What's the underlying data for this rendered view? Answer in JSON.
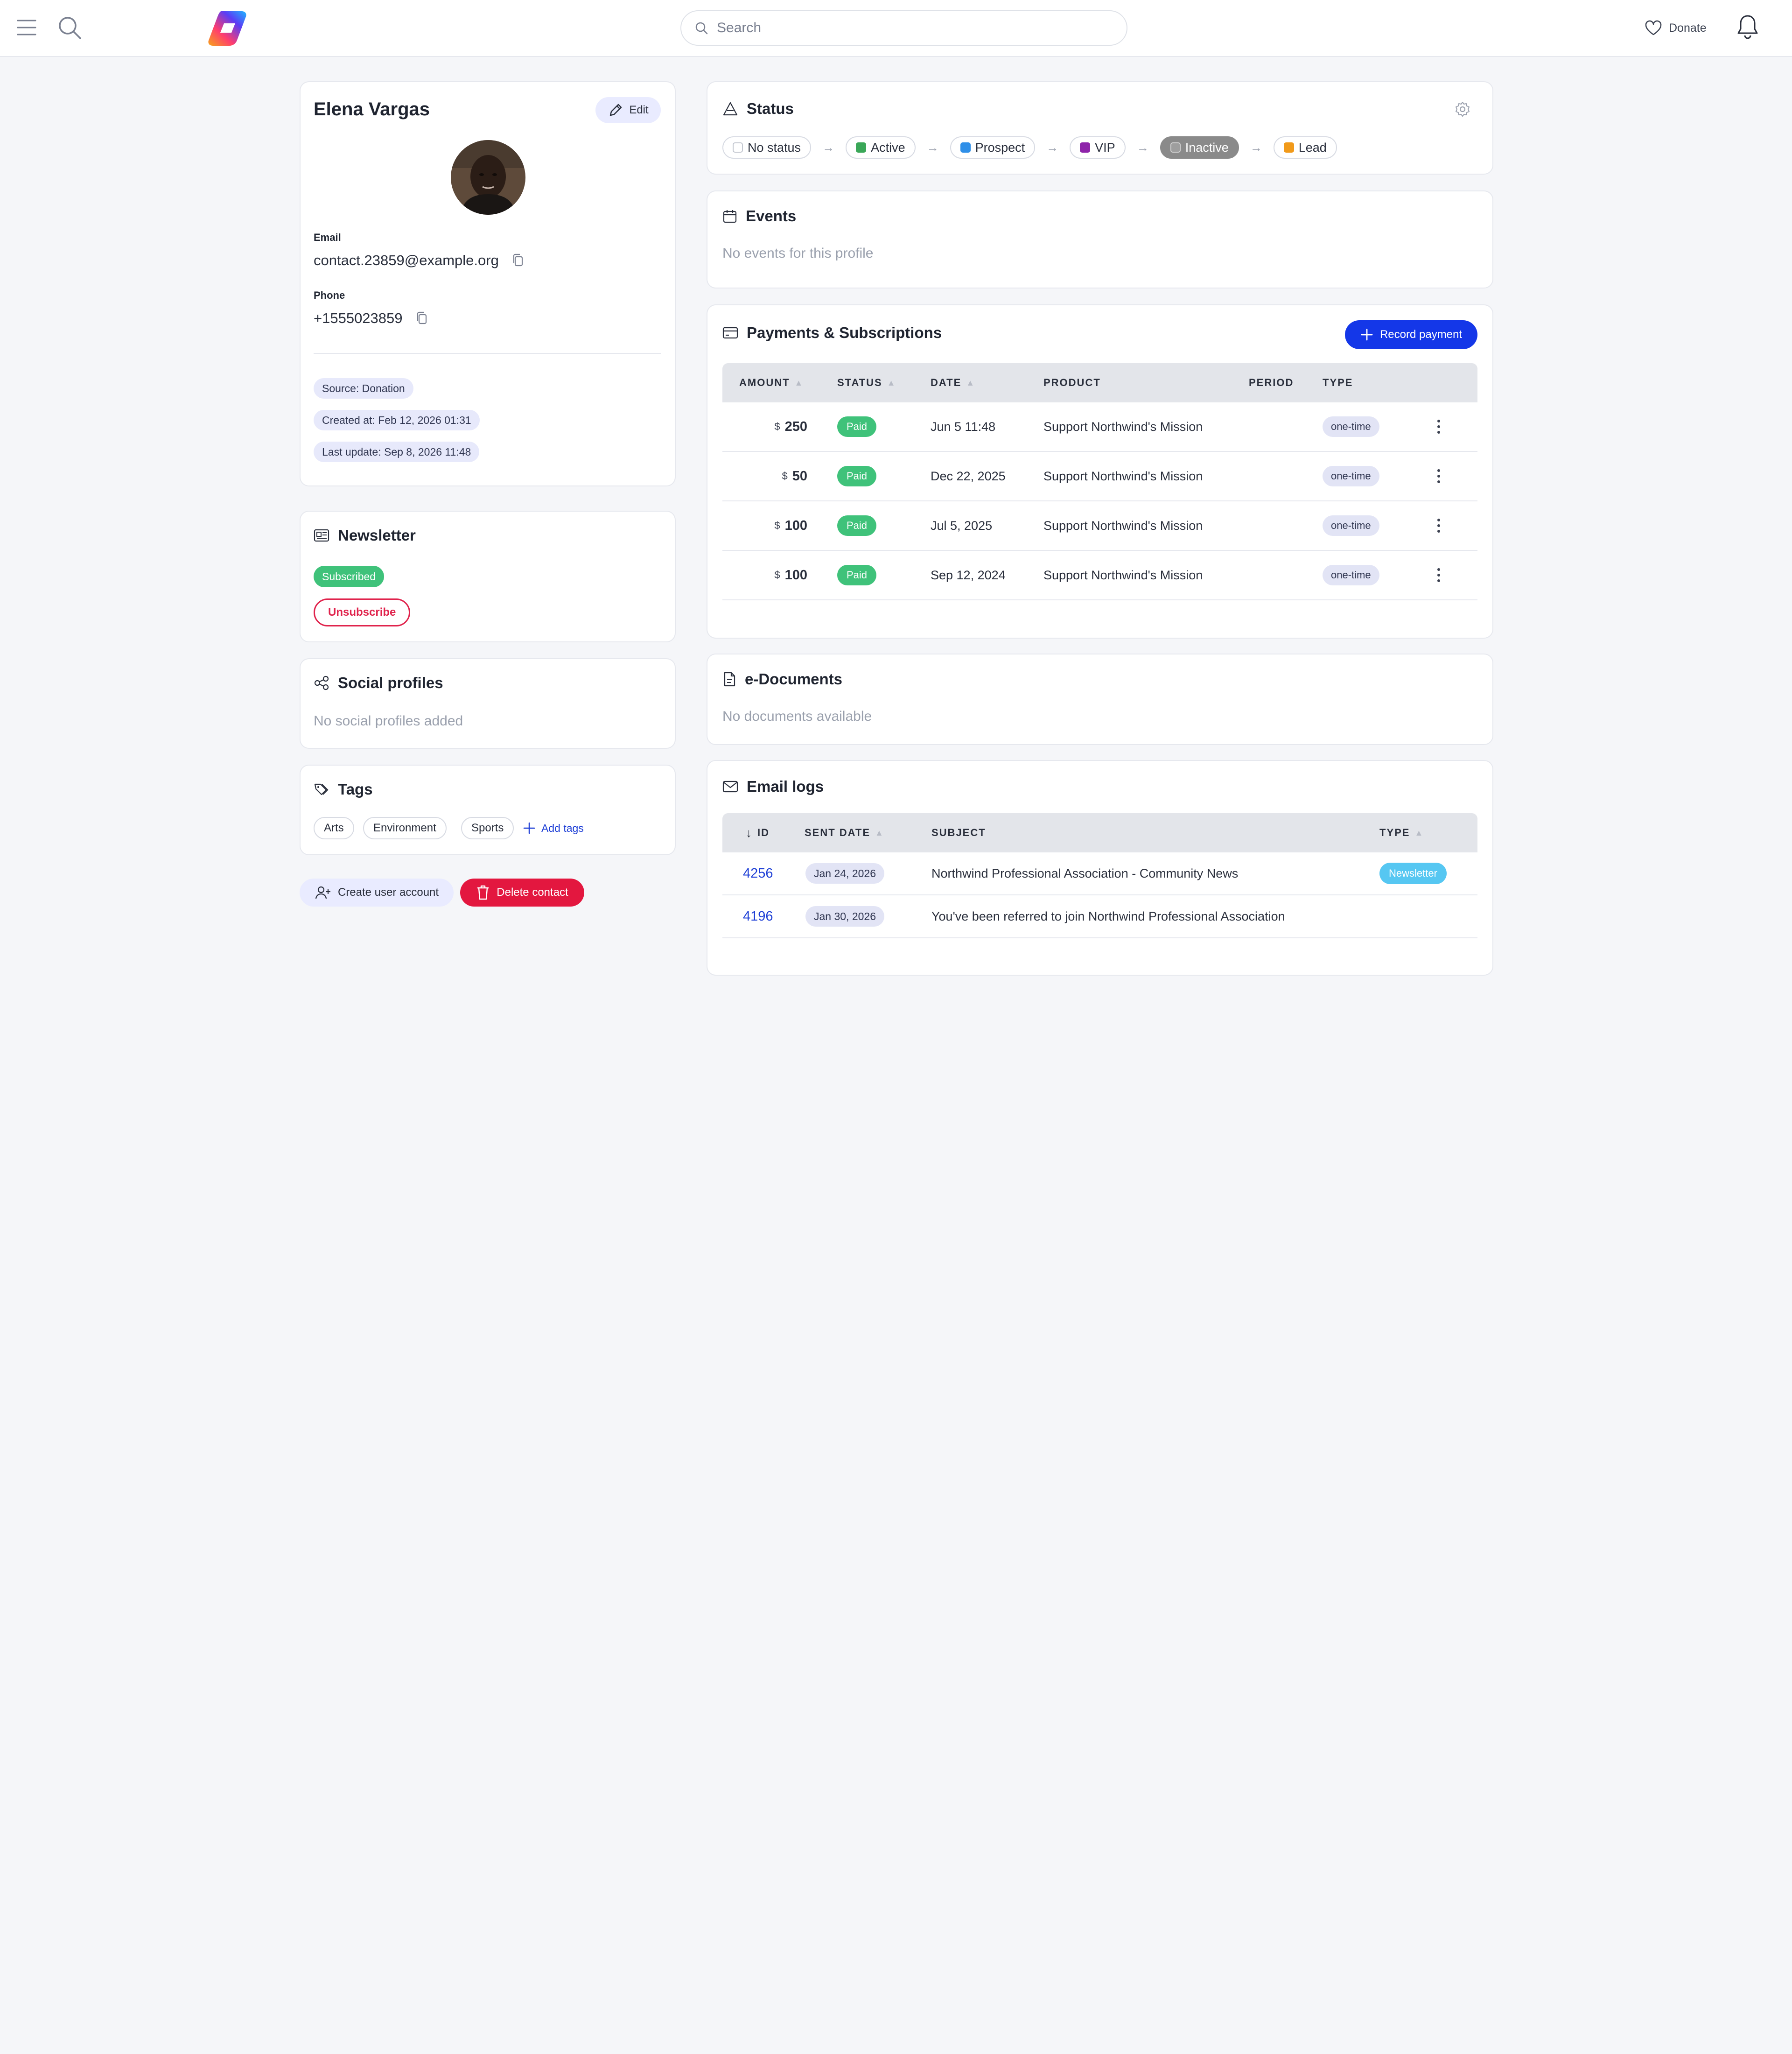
{
  "topbar": {
    "search_placeholder": "Search",
    "donate_label": "Donate"
  },
  "profile": {
    "name": "Elena Vargas",
    "edit_label": "Edit",
    "email_label": "Email",
    "email": "contact.23859@example.org",
    "phone_label": "Phone",
    "phone": "+1555023859",
    "meta": [
      "Source: Donation",
      "Created at: Feb 12, 2026 01:31",
      "Last update: Sep 8, 2026 11:48"
    ]
  },
  "newsletter": {
    "title": "Newsletter",
    "status": "Subscribed",
    "unsubscribe_label": "Unsubscribe",
    "status_color": "#3fc27a"
  },
  "social": {
    "title": "Social profiles",
    "empty": "No social profiles added"
  },
  "tags": {
    "title": "Tags",
    "items": [
      "Arts",
      "Environment",
      "Sports"
    ],
    "add_label": "Add tags"
  },
  "actions": {
    "create_user_label": "Create user account",
    "delete_label": "Delete contact",
    "delete_color": "#e3173f"
  },
  "status": {
    "title": "Status",
    "steps": [
      {
        "label": "No status",
        "color": "#ffffff"
      },
      {
        "label": "Active",
        "color": "#3aa758"
      },
      {
        "label": "Prospect",
        "color": "#2f8fe8"
      },
      {
        "label": "VIP",
        "color": "#8e24aa"
      },
      {
        "label": "Inactive",
        "color": "#9e9e9e",
        "selected": true
      },
      {
        "label": "Lead",
        "color": "#f19a1a"
      }
    ]
  },
  "events": {
    "title": "Events",
    "empty": "No events for this profile"
  },
  "payments": {
    "title": "Payments & Subscriptions",
    "record_label": "Record payment",
    "columns": {
      "amount": "AMOUNT",
      "status": "STATUS",
      "date": "DATE",
      "product": "PRODUCT",
      "period": "PERIOD",
      "type": "TYPE"
    },
    "rows": [
      {
        "currency": "$",
        "amount": "250",
        "status": "Paid",
        "date": "Jun 5 11:48",
        "product": "Support Northwind's Mission",
        "period": "",
        "type": "one-time"
      },
      {
        "currency": "$",
        "amount": "50",
        "status": "Paid",
        "date": "Dec 22, 2025",
        "product": "Support Northwind's Mission",
        "period": "",
        "type": "one-time"
      },
      {
        "currency": "$",
        "amount": "100",
        "status": "Paid",
        "date": "Jul 5, 2025",
        "product": "Support Northwind's Mission",
        "period": "",
        "type": "one-time"
      },
      {
        "currency": "$",
        "amount": "100",
        "status": "Paid",
        "date": "Sep 12, 2024",
        "product": "Support Northwind's Mission",
        "period": "",
        "type": "one-time"
      }
    ]
  },
  "documents": {
    "title": "e-Documents",
    "empty": "No documents available"
  },
  "email_logs": {
    "title": "Email logs",
    "columns": {
      "id": "ID",
      "sent_date": "SENT DATE",
      "subject": "SUBJECT",
      "type": "TYPE"
    },
    "rows": [
      {
        "id": "4256",
        "sent_date": "Jan 24, 2026",
        "subject": "Northwind Professional Association - Community News",
        "type": "Newsletter"
      },
      {
        "id": "4196",
        "sent_date": "Jan 30, 2026",
        "subject": "You've been referred to join Northwind Professional Association",
        "type": ""
      }
    ]
  }
}
